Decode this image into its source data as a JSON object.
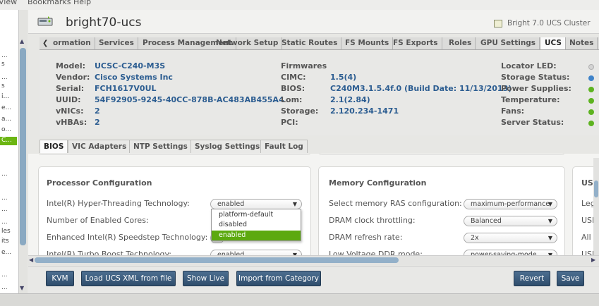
{
  "menubar": {
    "items": [
      "View",
      "Bookmarks",
      "Help"
    ]
  },
  "left_tree": {
    "rows": [
      "...",
      "s",
      "...",
      "s",
      "i...",
      "e...",
      "a...",
      "o...",
      "C...",
      "...",
      "...",
      "...",
      "...",
      "les",
      "its",
      "e...",
      "...",
      "..."
    ],
    "selected_index": 8
  },
  "header": {
    "hostname": "bright70-ucs",
    "cluster": "Bright 7.0 UCS Cluster"
  },
  "tabs": [
    "ormation",
    "Services",
    "Process Management",
    "Network Setup",
    "Static Routes",
    "FS Mounts",
    "FS Exports",
    "Roles",
    "GPU Settings",
    "UCS",
    "Notes"
  ],
  "active_tab": "UCS",
  "info": {
    "left": [
      {
        "label": "Model:",
        "value": "UCSC-C240-M3S"
      },
      {
        "label": "Vendor:",
        "value": "Cisco Systems Inc"
      },
      {
        "label": "Serial:",
        "value": "FCH1617V0UL"
      },
      {
        "label": "UUID:",
        "value": "54F92905-9245-40CC-878B-AC483AB455A4"
      },
      {
        "label": "vNICs:",
        "value": "2"
      },
      {
        "label": "vHBAs:",
        "value": "2"
      }
    ],
    "firmwares_title": "Firmwares",
    "firmwares": [
      {
        "label": "CIMC:",
        "value": "1.5(4)"
      },
      {
        "label": "BIOS:",
        "value": "C240M3.1.5.4f.0 (Build Date: 11/13/2013)"
      },
      {
        "label": "Lom:",
        "value": "2.1(2.84)"
      },
      {
        "label": "Storage:",
        "value": "2.120.234-1471"
      },
      {
        "label": "PCI:",
        "value": ""
      }
    ],
    "status": [
      {
        "label": "Locator LED:",
        "state": "off"
      },
      {
        "label": "Storage Status:",
        "state": "info"
      },
      {
        "label": "Power Supplies:",
        "state": "ok"
      },
      {
        "label": "Temperature:",
        "state": "ok"
      },
      {
        "label": "Fans:",
        "state": "ok"
      },
      {
        "label": "Server Status:",
        "state": "ok"
      }
    ]
  },
  "sub_tabs": [
    "BIOS",
    "VIC Adapters",
    "NTP Settings",
    "Syslog Settings",
    "Fault Log"
  ],
  "active_sub_tab": "BIOS",
  "processor": {
    "title": "Processor Configuration",
    "rows": [
      {
        "label": "Intel(R) Hyper-Threading Technology:",
        "value": "enabled"
      },
      {
        "label": "Number of Enabled Cores:",
        "value": ""
      },
      {
        "label": "Enhanced Intel(R) Speedstep Technology:",
        "value": ""
      },
      {
        "label": "Intel(R) Turbo Boost Technology:",
        "value": "enabled"
      }
    ]
  },
  "dropdown": {
    "options": [
      "platform-default",
      "disabled",
      "enabled"
    ],
    "highlighted": "enabled"
  },
  "memory": {
    "title": "Memory Configuration",
    "rows": [
      {
        "label": "Select memory RAS configuration:",
        "value": "maximum-performance"
      },
      {
        "label": "DRAM clock throttling:",
        "value": "Balanced"
      },
      {
        "label": "DRAM refresh rate:",
        "value": "2x"
      },
      {
        "label": "Low Voltage DDR mode:",
        "value": "power-saving-mode"
      }
    ]
  },
  "third_card": {
    "title": "USI",
    "rows": [
      "Leg",
      "USI",
      "All",
      "USI"
    ]
  },
  "buttons": {
    "kvm": "KVM",
    "load_xml": "Load UCS XML from file",
    "show_live": "Show Live",
    "import": "Import from Category",
    "revert": "Revert",
    "save": "Save"
  },
  "colors": {
    "ok": "#5db320",
    "info": "#3f83c9",
    "off": "#c8c8c8",
    "accent": "#6bb512",
    "button": "#3a5a7c"
  }
}
